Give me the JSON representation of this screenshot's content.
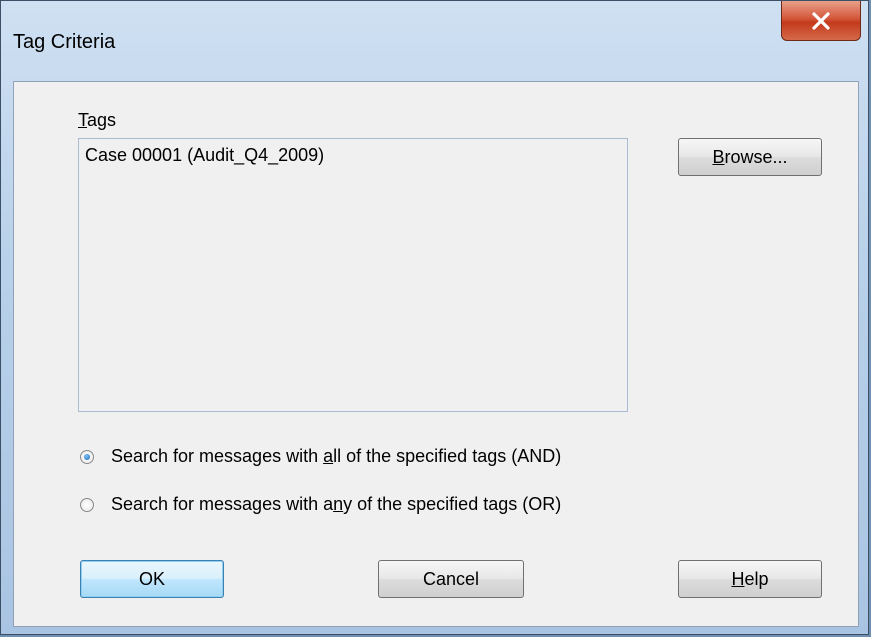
{
  "window": {
    "title": "Tag Criteria"
  },
  "tags": {
    "label_mnemonic": "T",
    "label_rest": "ags",
    "items": [
      "Case 00001 (Audit_Q4_2009)"
    ]
  },
  "buttons": {
    "browse_mnemonic": "B",
    "browse_rest": "rowse...",
    "ok": "OK",
    "cancel": "Cancel",
    "help_mnemonic": "H",
    "help_rest": "elp"
  },
  "options": {
    "and": {
      "prefix": "Search for messages with ",
      "mnemonic": "a",
      "rest": "ll of the specified tags (AND)",
      "checked": true
    },
    "or": {
      "prefix": "Search for messages with a",
      "mnemonic": "n",
      "rest": "y of the specified tags (OR)",
      "checked": false
    }
  },
  "icons": {
    "close": "close-x-icon"
  }
}
